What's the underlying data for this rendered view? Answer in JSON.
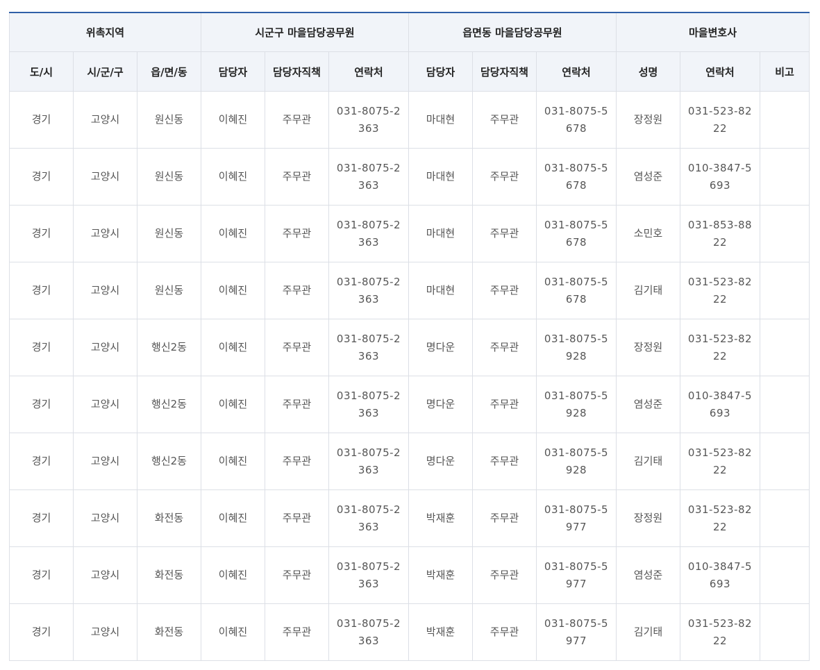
{
  "header": {
    "groups": [
      "위촉지역",
      "시군구 마을담당공무원",
      "읍면동 마을담당공무원",
      "마을변호사"
    ],
    "columns": [
      "도/시",
      "시/군/구",
      "읍/면/동",
      "담당자",
      "담당자직책",
      "연락처",
      "담당자",
      "담당자직책",
      "연락처",
      "성명",
      "연락처",
      "비고"
    ]
  },
  "rows": [
    [
      "경기",
      "고양시",
      "원신동",
      "이혜진",
      "주무관",
      "031-8075-2363",
      "마대현",
      "주무관",
      "031-8075-5678",
      "장정원",
      "031-523-8222",
      ""
    ],
    [
      "경기",
      "고양시",
      "원신동",
      "이혜진",
      "주무관",
      "031-8075-2363",
      "마대현",
      "주무관",
      "031-8075-5678",
      "염성준",
      "010-3847-5693",
      ""
    ],
    [
      "경기",
      "고양시",
      "원신동",
      "이혜진",
      "주무관",
      "031-8075-2363",
      "마대현",
      "주무관",
      "031-8075-5678",
      "소민호",
      "031-853-8822",
      ""
    ],
    [
      "경기",
      "고양시",
      "원신동",
      "이혜진",
      "주무관",
      "031-8075-2363",
      "마대현",
      "주무관",
      "031-8075-5678",
      "김기태",
      "031-523-8222",
      ""
    ],
    [
      "경기",
      "고양시",
      "행신2동",
      "이혜진",
      "주무관",
      "031-8075-2363",
      "명다운",
      "주무관",
      "031-8075-5928",
      "장정원",
      "031-523-8222",
      ""
    ],
    [
      "경기",
      "고양시",
      "행신2동",
      "이혜진",
      "주무관",
      "031-8075-2363",
      "명다운",
      "주무관",
      "031-8075-5928",
      "염성준",
      "010-3847-5693",
      ""
    ],
    [
      "경기",
      "고양시",
      "행신2동",
      "이혜진",
      "주무관",
      "031-8075-2363",
      "명다운",
      "주무관",
      "031-8075-5928",
      "김기태",
      "031-523-8222",
      ""
    ],
    [
      "경기",
      "고양시",
      "화전동",
      "이혜진",
      "주무관",
      "031-8075-2363",
      "박재훈",
      "주무관",
      "031-8075-5977",
      "장정원",
      "031-523-8222",
      ""
    ],
    [
      "경기",
      "고양시",
      "화전동",
      "이혜진",
      "주무관",
      "031-8075-2363",
      "박재훈",
      "주무관",
      "031-8075-5977",
      "염성준",
      "010-3847-5693",
      ""
    ],
    [
      "경기",
      "고양시",
      "화전동",
      "이혜진",
      "주무관",
      "031-8075-2363",
      "박재훈",
      "주무관",
      "031-8075-5977",
      "김기태",
      "031-523-8222",
      ""
    ]
  ]
}
